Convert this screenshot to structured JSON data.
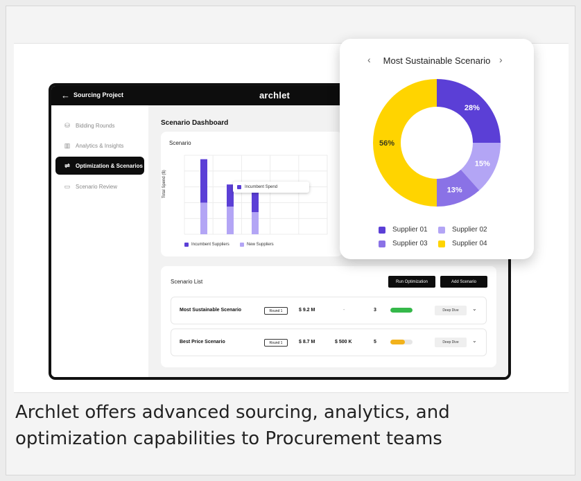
{
  "caption": "Archlet offers advanced sourcing, analytics, and optimization capabilities to Procurement teams",
  "app": {
    "project_title": "Sourcing Project",
    "brand": "archlet",
    "back_icon": "arrow-left-icon"
  },
  "sidebar": {
    "items": [
      {
        "label": "Bidding Rounds",
        "icon": "database-icon",
        "active": false
      },
      {
        "label": "Analytics & Insights",
        "icon": "bar-chart-icon",
        "active": false
      },
      {
        "label": "Optimization & Scenarios",
        "icon": "sliders-icon",
        "active": true
      },
      {
        "label": "Scenario Review",
        "icon": "document-icon",
        "active": false
      }
    ]
  },
  "dashboard": {
    "title": "Scenario Dashboard",
    "chart_card_title": "Scenario",
    "tooltip": "Incumbent Spend"
  },
  "chart_data": [
    {
      "type": "bar",
      "title": "Scenario",
      "ylabel": "Total Spend ($)",
      "categories": [
        "",
        "",
        ""
      ],
      "series": [
        {
          "name": "Incumbent Suppliers",
          "color": "#5b3fd6",
          "values": [
            55,
            28,
            25
          ]
        },
        {
          "name": "New Suppliers",
          "color": "#b3a5f5",
          "values": [
            40,
            35,
            28
          ]
        }
      ],
      "stacked": true,
      "grid": true,
      "legend": "bottom"
    },
    {
      "type": "pie",
      "title": "Most Sustainable Scenario",
      "donut": true,
      "labels": [
        "Supplier 01",
        "Supplier 02",
        "Supplier 03",
        "Supplier 04"
      ],
      "values": [
        28,
        15,
        13,
        56
      ],
      "value_labels": [
        "28%",
        "15%",
        "13%",
        "56%"
      ],
      "colors": [
        "#5b3fd6",
        "#b3a5f5",
        "#8a72e6",
        "#ffd400"
      ],
      "legend": "bottom"
    }
  ],
  "scenario_list": {
    "title": "Scenario List",
    "run_button": "Run Optimization",
    "add_button": "Add Scenario",
    "rows": [
      {
        "name": "Most Sustainable Scenario",
        "round": "Round 1",
        "spend": "$ 9.2 M",
        "savings": "-",
        "count": "3",
        "progress": 1.0,
        "bar_color": "#35b84a",
        "action": "Deep Dive"
      },
      {
        "name": "Best Price Scenario",
        "round": "Round 1",
        "spend": "$ 8.7 M",
        "savings": "$ 500 K",
        "count": "5",
        "progress": 0.65,
        "bar_color": "#f2b21b",
        "action": "Deep Dive"
      }
    ]
  },
  "popover": {
    "title": "Most Sustainable Scenario",
    "prev_icon": "chevron-left-icon",
    "next_icon": "chevron-right-icon"
  }
}
